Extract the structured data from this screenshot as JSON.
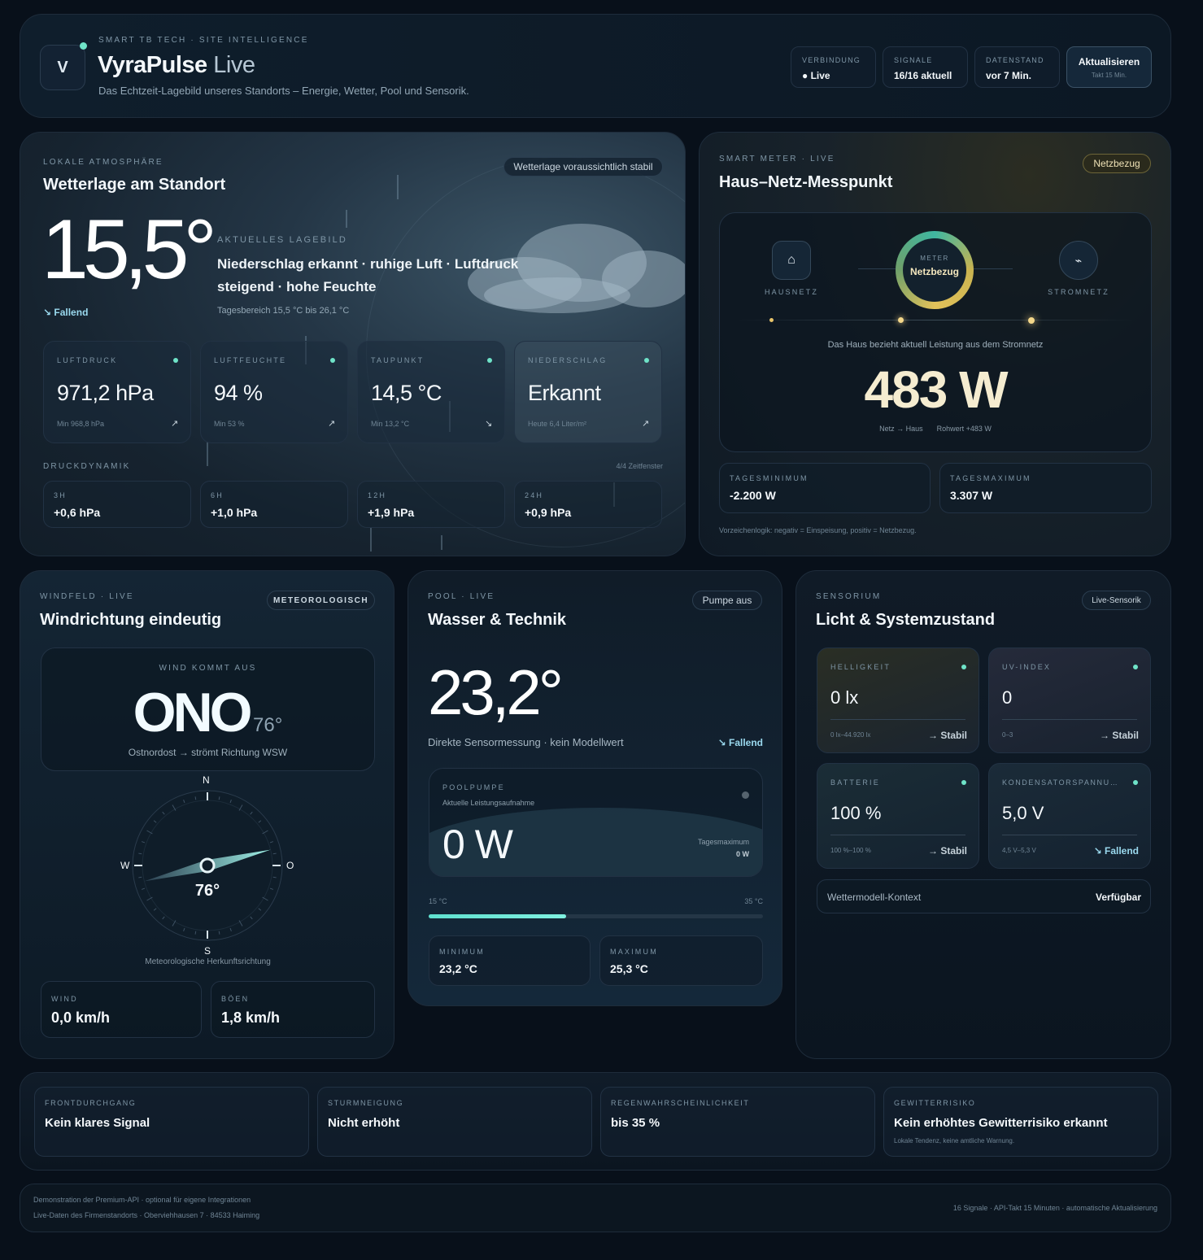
{
  "header": {
    "logo_letter": "V",
    "eyebrow": "SMART TB TECH · SITE INTELLIGENCE",
    "app_name": "VyraPulse",
    "app_suffix": "Live",
    "tagline": "Das Echtzeit-Lagebild unseres Standorts – Energie, Wetter, Pool und Sensorik.",
    "status": [
      {
        "label": "VERBINDUNG",
        "value": "● Live"
      },
      {
        "label": "SIGNALE",
        "value": "16/16 aktuell"
      },
      {
        "label": "DATENSTAND",
        "value": "vor 7 Min."
      }
    ],
    "refresh_label": "Aktualisieren",
    "refresh_sub": "Takt 15 Min."
  },
  "weather": {
    "eyebrow": "LOKALE ATMOSPHÄRE",
    "title": "Wetterlage am Standort",
    "badge": "Wetterlage voraussichtlich stabil",
    "temp": "15,5°",
    "trend": "↘ Fallend",
    "situation_label": "AKTUELLES LAGEBILD",
    "situation_line1": "Niederschlag erkannt · ruhige Luft · Luftdruck",
    "situation_line2": "steigend · hohe Feuchte",
    "day_range": "Tagesbereich 15,5 °C bis 26,1 °C",
    "metrics": [
      {
        "label": "LUFTDRUCK",
        "value": "971,2 hPa",
        "sub": "Min 968,8 hPa",
        "arrow": "↗"
      },
      {
        "label": "LUFTFEUCHTE",
        "value": "94 %",
        "sub": "Min 53 %",
        "arrow": "↗"
      },
      {
        "label": "TAUPUNKT",
        "value": "14,5 °C",
        "sub": "Min 13,2 °C",
        "arrow": "↘"
      },
      {
        "label": "NIEDERSCHLAG",
        "value": "Erkannt",
        "sub": "Heute 6,4 Liter/m²",
        "arrow": "↗"
      }
    ],
    "dyn_label": "DRUCKDYNAMIK",
    "dyn_windows": "4/4 Zeitfenster",
    "dynamics": [
      {
        "label": "3H",
        "value": "+0,6 hPa"
      },
      {
        "label": "6H",
        "value": "+1,0 hPa"
      },
      {
        "label": "12H",
        "value": "+1,9 hPa"
      },
      {
        "label": "24H",
        "value": "+0,9 hPa"
      }
    ]
  },
  "meter": {
    "eyebrow": "SMART METER · LIVE",
    "title": "Haus–Netz-Messpunkt",
    "badge": "Netzbezug",
    "left_label": "HAUSNETZ",
    "right_label": "STROMNETZ",
    "ring_label": "METER",
    "ring_value": "Netzbezug",
    "description": "Das Haus bezieht aktuell Leistung aus dem Stromnetz",
    "power": "483 W",
    "flow": "Netz → Haus",
    "raw": "Rohwert +483 W",
    "min_label": "TAGESMINIMUM",
    "min_value": "-2.200 W",
    "max_label": "TAGESMAXIMUM",
    "max_value": "3.307 W",
    "note": "Vorzeichenlogik: negativ = Einspeisung, positiv = Netzbezug."
  },
  "wind": {
    "eyebrow": "WINDFELD · LIVE",
    "title": "Windrichtung eindeutig",
    "badge": "METEOROLOGISCH",
    "from_label": "WIND KOMMT AUS",
    "direction": "ONO",
    "degrees": "76°",
    "desc": "Ostnordost → strömt Richtung WSW",
    "compass_n": "N",
    "compass_s": "S",
    "compass_w": "W",
    "compass_o": "O",
    "compass_deg": "76°",
    "compass_caption": "Meteorologische Herkunftsrichtung",
    "speed_label": "WIND",
    "speed_value": "0,0 km/h",
    "gust_label": "BÖEN",
    "gust_value": "1,8 km/h",
    "heading_deg": 76
  },
  "pool": {
    "eyebrow": "POOL · LIVE",
    "title": "Wasser & Technik",
    "badge": "Pumpe aus",
    "temp": "23,2°",
    "desc": "Direkte Sensormessung · kein Modellwert",
    "trend": "↘ Fallend",
    "pump_label": "POOLPUMPE",
    "pump_sub": "Aktuelle Leistungsaufnahme",
    "pump_value": "0 W",
    "pump_max_label": "Tagesmaximum",
    "pump_max_value": "0 W",
    "scale_min": "15 °C",
    "scale_max": "35 °C",
    "scale_fraction": 0.41,
    "min_label": "MINIMUM",
    "min_value": "23,2 °C",
    "max_label": "MAXIMUM",
    "max_value": "25,3 °C"
  },
  "sensors": {
    "eyebrow": "SENSORIUM",
    "title": "Licht & Systemzustand",
    "badge": "Live-Sensorik",
    "tiles": [
      {
        "label": "HELLIGKEIT",
        "value": "0 lx",
        "range": "0 lx–44.920 lx",
        "trend": "→ Stabil"
      },
      {
        "label": "UV-INDEX",
        "value": "0",
        "range": "0–3",
        "trend": "→ Stabil"
      },
      {
        "label": "BATTERIE",
        "value": "100 %",
        "range": "100 %–100 %",
        "trend": "→ Stabil"
      },
      {
        "label": "KONDENSATORSPANNU…",
        "value": "5,0 V",
        "range": "4,5 V–5,3 V",
        "trend": "↘ Fallend"
      }
    ],
    "context_label": "Wettermodell-Kontext",
    "context_value": "Verfügbar"
  },
  "bottom": [
    {
      "label": "FRONTDURCHGANG",
      "value": "Kein klares Signal",
      "note": ""
    },
    {
      "label": "STURMNEIGUNG",
      "value": "Nicht erhöht",
      "note": ""
    },
    {
      "label": "REGENWAHRSCHEINLICHKEIT",
      "value": "bis 35 %",
      "note": ""
    },
    {
      "label": "GEWITTERRISIKO",
      "value": "Kein erhöhtes Gewitterrisiko erkannt",
      "note": "Lokale Tendenz, keine amtliche Warnung."
    }
  ],
  "footer": {
    "line1": "Demonstration der Premium-API · optional für eigene Integrationen",
    "line2": "Live-Daten des Firmenstandorts · Oberviehhausen 7 · 84533 Haiming",
    "right": "16 Signale · API-Takt 15 Minuten · automatische Aktualisierung"
  }
}
